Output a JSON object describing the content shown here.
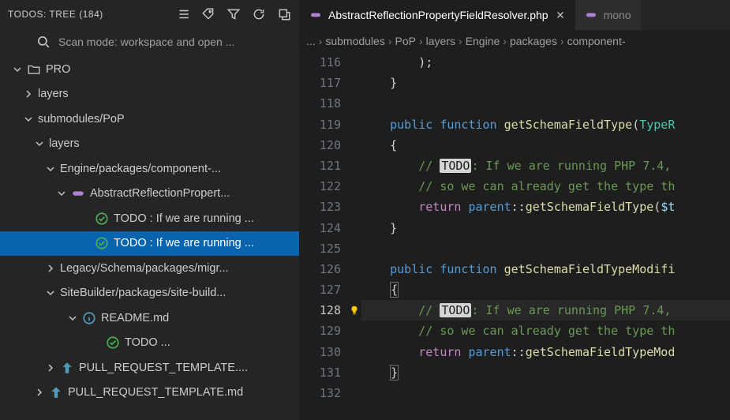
{
  "sidebar": {
    "title": "TODOS: TREE (184)",
    "search": "Scan mode: workspace and open ...",
    "tree": [
      {
        "indent": 14,
        "chev": "down",
        "icon": "folder",
        "label": "PRO"
      },
      {
        "indent": 28,
        "chev": "right",
        "icon": "",
        "label": "layers"
      },
      {
        "indent": 28,
        "chev": "down",
        "icon": "",
        "label": "submodules/PoP"
      },
      {
        "indent": 42,
        "chev": "down",
        "icon": "",
        "label": "layers"
      },
      {
        "indent": 56,
        "chev": "down",
        "icon": "",
        "label": "Engine/packages/component-..."
      },
      {
        "indent": 70,
        "chev": "down",
        "icon": "php",
        "label": "AbstractReflectionPropert..."
      },
      {
        "indent": 100,
        "chev": "",
        "icon": "check",
        "label": "TODO : If we are running ..."
      },
      {
        "indent": 100,
        "chev": "",
        "icon": "check",
        "label": "TODO : If we are running ...",
        "selected": true
      },
      {
        "indent": 56,
        "chev": "right",
        "icon": "",
        "label": "Legacy/Schema/packages/migr..."
      },
      {
        "indent": 56,
        "chev": "down",
        "icon": "",
        "label": "SiteBuilder/packages/site-build..."
      },
      {
        "indent": 84,
        "chev": "down",
        "icon": "info",
        "label": "README.md"
      },
      {
        "indent": 114,
        "chev": "",
        "icon": "check",
        "label": "TODO ..."
      },
      {
        "indent": 56,
        "chev": "right",
        "icon": "md",
        "label": "PULL_REQUEST_TEMPLATE...."
      },
      {
        "indent": 42,
        "chev": "right",
        "icon": "md",
        "label": "PULL_REQUEST_TEMPLATE.md"
      }
    ]
  },
  "tabs": {
    "active": "AbstractReflectionPropertyFieldResolver.php",
    "inactive": "mono"
  },
  "breadcrumbs": [
    "...",
    "submodules",
    "PoP",
    "layers",
    "Engine",
    "packages",
    "component-"
  ],
  "lines": [
    116,
    117,
    118,
    119,
    120,
    121,
    122,
    123,
    124,
    125,
    126,
    127,
    128,
    129,
    130,
    131,
    132
  ],
  "current_line": 128,
  "code": {
    "l116": "        );",
    "l117": "    }",
    "l119_pre": "    ",
    "l119_kw1": "public",
    "l119_kw2": "function",
    "l119_fn": "getSchemaFieldType",
    "l119_ty": "TypeR",
    "l120": "    {",
    "l121_pre": "        ",
    "l121_cm1": "// ",
    "l121_todo": "TODO",
    "l121_cm2": ": If we are running PHP 7.4,",
    "l122": "        // so we can already get the type th",
    "l123_pre": "        ",
    "l123_kw": "return",
    "l123_cl": "parent",
    "l123_fn": "getSchemaFieldType",
    "l123_va": "$t",
    "l124": "    }",
    "l126_pre": "    ",
    "l126_kw1": "public",
    "l126_kw2": "function",
    "l126_fn": "getSchemaFieldTypeModifi",
    "l127": "    ",
    "l127_brace": "{",
    "l128_pre": "        ",
    "l128_cm1": "// ",
    "l128_todo": "TODO",
    "l128_cm2": ": If we are running PHP 7.4,",
    "l129": "        // so we can already get the type th",
    "l130_pre": "        ",
    "l130_kw": "return",
    "l130_cl": "parent",
    "l130_fn": "getSchemaFieldTypeMod",
    "l131": "    ",
    "l131_brace": "}"
  }
}
